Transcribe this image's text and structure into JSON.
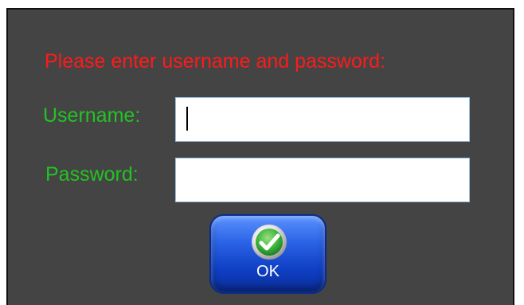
{
  "dialog": {
    "prompt": "Please enter username and password:",
    "username": {
      "label": "Username:",
      "value": "",
      "placeholder": ""
    },
    "password": {
      "label": "Password:",
      "value": "",
      "placeholder": ""
    },
    "ok_button": {
      "label": "OK",
      "icon": "checkmark-icon"
    }
  },
  "colors": {
    "background": "#444444",
    "prompt_text": "#ff1a1a",
    "field_label_text": "#22c322",
    "ok_button": "#1a4fd6",
    "check_icon": "#3fb43f"
  }
}
